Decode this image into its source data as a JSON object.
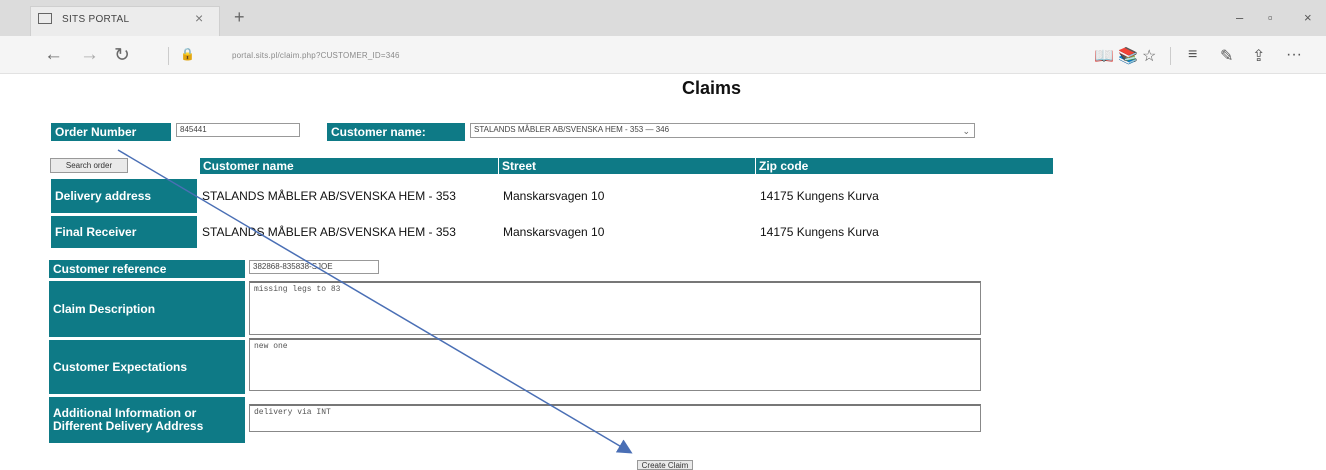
{
  "browser": {
    "tab_title": "SITS PORTAL",
    "tab_close": "×",
    "new_tab": "+",
    "url": "portal.sits.pl/claim.php?CUSTOMER_ID=346",
    "win_min": "–",
    "win_max": "▫",
    "win_close": "×",
    "nav_back": "←",
    "nav_forward": "→",
    "nav_refresh": "↻",
    "lock": "🔒",
    "toolbar_reading": "📖",
    "toolbar_book": "📚",
    "toolbar_star": "☆",
    "toolbar_hub": "≡",
    "toolbar_note": "✎",
    "toolbar_share": "⇪",
    "toolbar_more": "···"
  },
  "page": {
    "title": "Claims",
    "order_number_label": "Order Number",
    "order_number_value": "845441",
    "customer_name_label": "Customer name:",
    "customer_select_value": "STALANDS MÅBLER AB/SVENSKA HEM - 353 — 346",
    "search_order_button": "Search order",
    "columns": {
      "customer_name": "Customer name",
      "street": "Street",
      "zip": "Zip code"
    },
    "rows": [
      {
        "label": "Delivery address",
        "name": "STALANDS MÅBLER AB/SVENSKA HEM - 353",
        "street": "Manskarsvagen 10",
        "zip": "14175 Kungens Kurva"
      },
      {
        "label": "Final Receiver",
        "name": "STALANDS MÅBLER AB/SVENSKA HEM - 353",
        "street": "Manskarsvagen 10",
        "zip": "14175 Kungens Kurva"
      }
    ],
    "customer_reference_label": "Customer reference",
    "customer_reference_value": "382868-835838-SJOE",
    "claim_description_label": "Claim Description",
    "claim_description_value": "missing legs to 83",
    "customer_expectations_label": "Customer Expectations",
    "customer_expectations_value": "new one",
    "additional_info_label": "Additional Information or Different Delivery Address",
    "additional_info_value": "delivery via INT",
    "create_claim_button": "Create Claim"
  },
  "colors": {
    "label_bg": "#0e7a86",
    "annotation_arrow": "#4a6fb5"
  }
}
